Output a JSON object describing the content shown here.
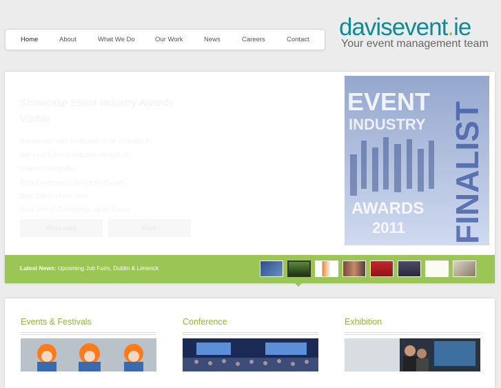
{
  "nav": {
    "items": [
      "Home",
      "About",
      "What We Do",
      "Our Work",
      "News",
      "Careers",
      "Contact"
    ],
    "active": "Home"
  },
  "logo": {
    "main": "davisevent",
    "dot": ".",
    "tld": "ie",
    "tagline": "Your event management team"
  },
  "slide": {
    "title": "Showcase Event Industry Awards Visible",
    "lines": [
      "Davisevent was honoured to be a finalist in",
      "this year's Event Industry Awards in",
      "several categories",
      "Best Conference Venue for Events",
      "Best Event of the Year",
      "Best Use of Technology at an Event"
    ],
    "btn1": "Read more",
    "btn2": "More",
    "poster_top": "EVENT",
    "poster_mid": "INDUSTRY",
    "poster_awards": "AWARDS",
    "poster_year": "2011",
    "poster_side": "FINALIST"
  },
  "newsbar": {
    "label": "Latest News:",
    "text": "Upcoming Job Fairs, Dublin & Limerick",
    "thumb_icons": [
      "irish-tech-thumb",
      "silhouettes-thumb",
      "logo-thumb",
      "people-thumb",
      "expo-thumb",
      "crowd-thumb",
      "ribbon-thumb",
      "dog-thumb"
    ]
  },
  "columns": [
    {
      "title": "Events & Festivals"
    },
    {
      "title": "Conference"
    },
    {
      "title": "Exhibition"
    }
  ],
  "colors": {
    "green": "#9bc554",
    "teal": "#0e8b96",
    "title_green": "#8fb93b"
  }
}
